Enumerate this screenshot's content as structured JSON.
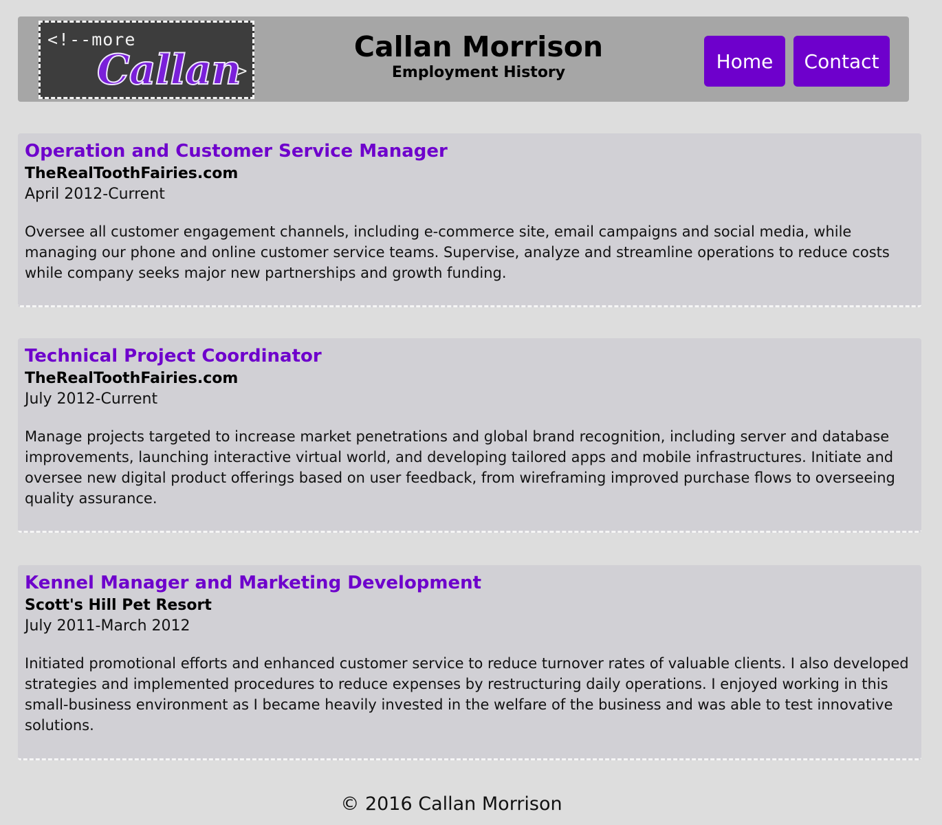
{
  "header": {
    "logo": {
      "code_text": "<!--more",
      "name_text": "Callan",
      "close_text": ">"
    },
    "title": "Callan Morrison",
    "subtitle": "Employment History",
    "nav": [
      {
        "label": "Home"
      },
      {
        "label": "Contact"
      }
    ]
  },
  "jobs": [
    {
      "title": "Operation and Customer Service Manager",
      "company": "TheRealToothFairies.com",
      "dates": "April 2012-Current",
      "description": "Oversee all customer engagement channels, including e-commerce site, email campaigns and social media, while managing our phone and online customer service teams. Supervise, analyze and streamline operations to reduce costs while company seeks major new partnerships and growth funding."
    },
    {
      "title": "Technical Project Coordinator",
      "company": "TheRealToothFairies.com",
      "dates": "July 2012-Current",
      "description": "Manage projects targeted to increase market penetrations and global brand recognition, including server and database improvements, launching interactive virtual world, and developing tailored apps and mobile infrastructures. Initiate and oversee new digital product offerings based on user feedback, from wireframing improved purchase flows to overseeing quality assurance."
    },
    {
      "title": "Kennel Manager and Marketing Development",
      "company": "Scott's Hill Pet Resort",
      "dates": "July 2011-March 2012",
      "description": "Initiated promotional efforts and enhanced customer service to reduce turnover rates of valuable clients. I also developed strategies and implemented procedures to reduce expenses by restructuring daily operations. I enjoyed working in this small-business environment as I became heavily invested in the welfare of the business and was able to test innovative solutions."
    }
  ],
  "footer": {
    "text": "© 2016 Callan Morrison"
  },
  "colors": {
    "page_background": "#dddddd",
    "header_background": "#a6a6a6",
    "card_background": "#d1d0d5",
    "accent_purple": "#6e00cc",
    "logo_background": "#3d3d3d"
  }
}
